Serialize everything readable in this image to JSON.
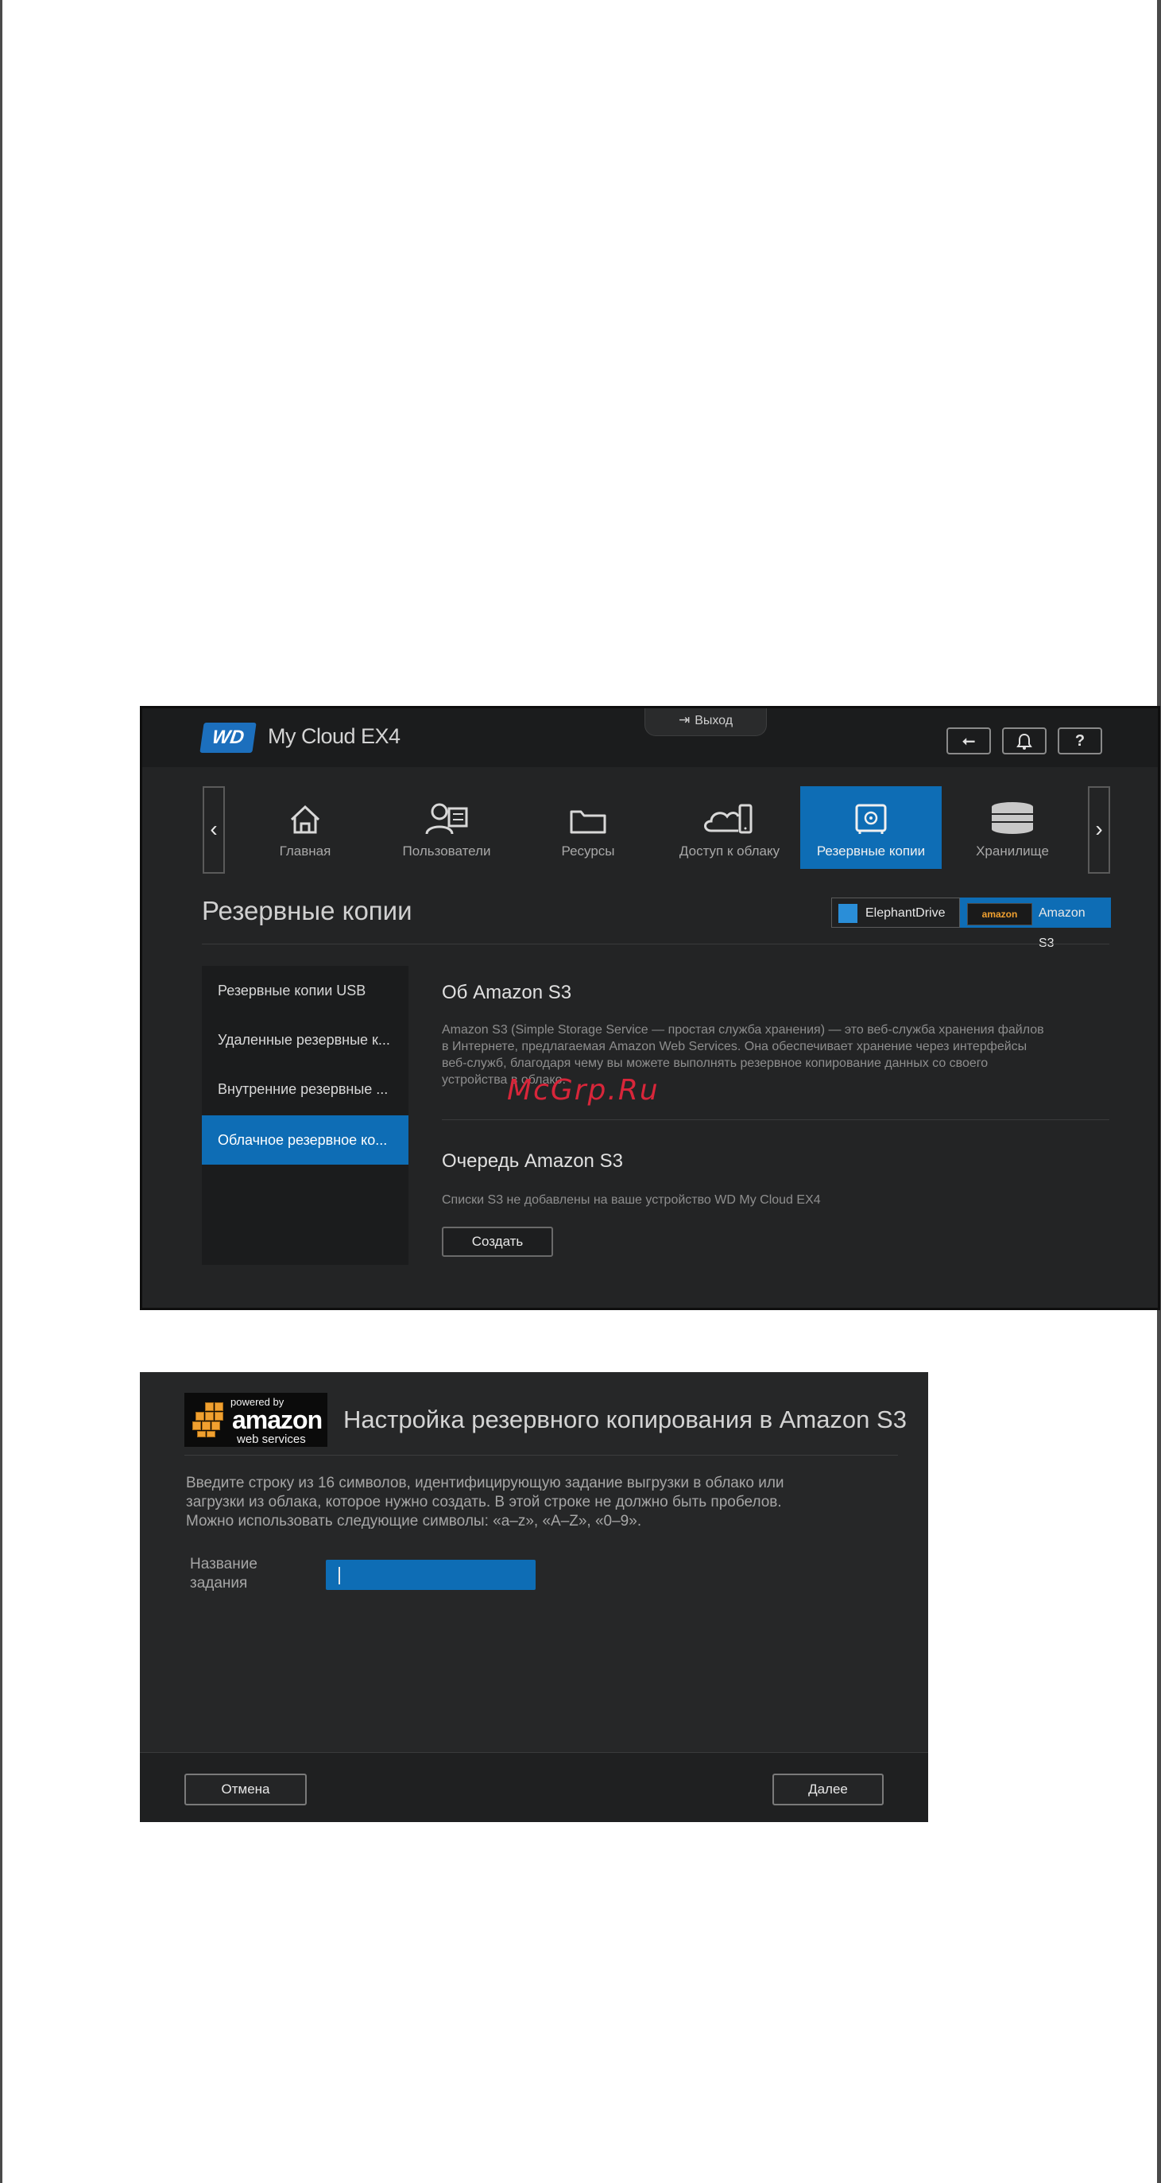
{
  "screenshot1": {
    "app": {
      "logo_text": "WD",
      "title": "My Cloud EX4"
    },
    "top_bar": {
      "logout_label": "Выход",
      "help_label": "?"
    },
    "nav": {
      "items": [
        {
          "label": "Главная",
          "icon": "home-icon"
        },
        {
          "label": "Пользователи",
          "icon": "users-icon"
        },
        {
          "label": "Ресурсы",
          "icon": "folder-icon"
        },
        {
          "label": "Доступ к облаку",
          "icon": "cloud-device-icon"
        },
        {
          "label": "Резервные копии",
          "icon": "safe-icon",
          "active": true
        },
        {
          "label": "Хранилище",
          "icon": "storage-stack-icon"
        }
      ]
    },
    "section_title": "Резервные копии",
    "provider_tabs": {
      "elephant": "ElephantDrive",
      "amazon": "Amazon S3",
      "amazon_logo_text": "amazon"
    },
    "side_menu": [
      {
        "label": "Резервные копии USB"
      },
      {
        "label": "Удаленные резервные к..."
      },
      {
        "label": "Внутренние резервные ..."
      },
      {
        "label": "Облачное резервное ко...",
        "active": true
      }
    ],
    "about": {
      "heading": "Об Amazon S3",
      "lines": [
        "Amazon S3 (Simple Storage Service — простая служба хранения) — это веб-служба хранения файлов",
        "в Интернете, предлагаемая Amazon Web Services. Она обеспечивает хранение через интерфейсы",
        "веб-служб, благодаря чему вы можете выполнять резервное копирование данных со своего",
        "устройства в облако."
      ]
    },
    "queue": {
      "heading": "Очередь Amazon S3",
      "text": "Списки S3 не добавлены на ваше устройство WD My Cloud EX4",
      "create_label": "Создать"
    },
    "watermark": "McGrp.Ru"
  },
  "screenshot2": {
    "logo": {
      "powered": "powered by",
      "amazon": "amazon",
      "webservices": "web services"
    },
    "title": "Настройка резервного копирования в Amazon S3",
    "instructions": [
      "Введите строку из 16 символов, идентифицирующую задание выгрузки в облако или",
      "загрузки из облака, которое нужно создать. В этой строке не должно быть пробелов.",
      "Можно использовать следующие символы: «a–z», «A–Z», «0–9»."
    ],
    "field": {
      "label_line1": "Название",
      "label_line2": "задания",
      "value": ""
    },
    "cancel_label": "Отмена",
    "next_label": "Далее"
  },
  "colors": {
    "accent": "#0e6db5",
    "panel": "#232425",
    "aws_orange": "#f0a030"
  }
}
